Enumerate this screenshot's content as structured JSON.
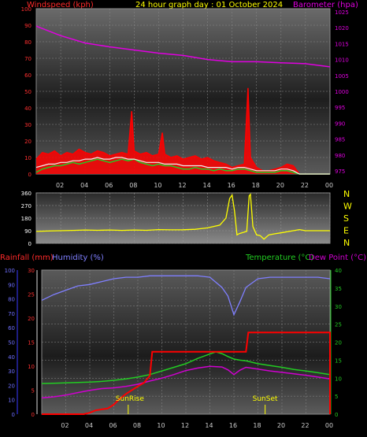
{
  "header": {
    "windspeed_label": "Windspeed (kph)",
    "title": "24 hour graph day : 01 October 2024",
    "barometer_label": "Barometer (hpa)"
  },
  "colors": {
    "background": "#000000",
    "wind": "#ff0000",
    "gust": "#ff0000",
    "barometer": "#e000e0",
    "direction": "#ffff00",
    "temperature": "#22cc22",
    "dewpoint": "#d000d0",
    "humidity": "#7f7fff",
    "rainfall": "#ff0000",
    "header_wind": "#ff2a2a",
    "header_title": "#ffff00",
    "header_baro": "#e000e0",
    "left_axis3": "#3a3aff",
    "right_axis3": "#22cc22"
  },
  "x_ticks": [
    "02",
    "04",
    "06",
    "08",
    "10",
    "12",
    "14",
    "16",
    "18",
    "20",
    "22",
    "00"
  ],
  "direction_labels": [
    "N",
    "W",
    "S",
    "E",
    "N"
  ],
  "chart_data": [
    {
      "type": "line",
      "name": "wind-barometer",
      "title": "24 hour graph day : 01 October 2024",
      "ylabel_left": "Windspeed (kph)",
      "ylabel_right": "Barometer (hpa)",
      "y_left_ticks": [
        0,
        10,
        20,
        30,
        40,
        50,
        60,
        70,
        80,
        90,
        100
      ],
      "y_left_range": [
        0,
        100
      ],
      "y_right_ticks": [
        975,
        980,
        985,
        990,
        995,
        1000,
        1005,
        1010,
        1015,
        1020,
        1025
      ],
      "y_right_range": [
        974,
        1026
      ],
      "series": [
        {
          "name": "Barometer",
          "axis": "right",
          "x": [
            0,
            2,
            4,
            6,
            8,
            10,
            12,
            14,
            16,
            18,
            20,
            22,
            24
          ],
          "values": [
            1020.5,
            1017.5,
            1015.2,
            1014.0,
            1013.0,
            1012.0,
            1011.3,
            1010.0,
            1009.3,
            1009.3,
            1009.0,
            1008.7,
            1007.7
          ]
        },
        {
          "name": "Gust",
          "axis": "left",
          "x": [
            0,
            0.5,
            1,
            1.5,
            2,
            2.5,
            3,
            3.5,
            4,
            4.5,
            5,
            5.5,
            6,
            6.5,
            7,
            7.5,
            7.8,
            8,
            8.5,
            9,
            9.5,
            10,
            10.3,
            10.5,
            11,
            11.5,
            12,
            12.5,
            13,
            13.5,
            14,
            14.5,
            15,
            15.5,
            16,
            16.5,
            17,
            17.3,
            17.5,
            18,
            18.5,
            19,
            19.5,
            20,
            20.5,
            21,
            21.5,
            22,
            22.5,
            23,
            24
          ],
          "values": [
            9,
            13,
            12,
            14,
            11,
            13,
            12,
            15,
            13,
            12,
            14,
            13,
            11,
            12,
            13,
            12,
            38,
            14,
            12,
            13,
            11,
            12,
            25,
            12,
            10,
            11,
            9,
            10,
            11,
            9,
            10,
            8,
            7,
            6,
            4,
            5,
            6,
            52,
            10,
            4,
            2,
            2,
            3,
            4,
            6,
            5,
            0,
            0,
            0,
            0,
            0
          ]
        },
        {
          "name": "Average",
          "axis": "left",
          "x": [
            0,
            0.5,
            1,
            1.5,
            2,
            2.5,
            3,
            3.5,
            4,
            4.5,
            5,
            5.5,
            6,
            6.5,
            7,
            7.5,
            8,
            8.5,
            9,
            9.5,
            10,
            10.5,
            11,
            11.5,
            12,
            12.5,
            13,
            13.5,
            14,
            14.5,
            15,
            15.5,
            16,
            16.5,
            17,
            17.5,
            18,
            18.5,
            19,
            19.5,
            20,
            20.5,
            21,
            21.5,
            22,
            23,
            24
          ],
          "values": [
            1,
            3,
            4,
            5,
            5,
            6,
            7,
            6,
            7,
            8,
            9,
            8,
            7,
            8,
            9,
            8,
            9,
            7,
            6,
            5,
            6,
            5,
            5,
            4,
            3,
            3,
            4,
            3,
            3,
            2,
            3,
            2,
            2,
            3,
            3,
            2,
            1,
            1,
            1,
            1,
            2,
            2,
            1,
            0,
            0,
            0,
            0
          ]
        },
        {
          "name": "Gust peak",
          "axis": "left",
          "x": [
            0,
            0.5,
            1,
            1.5,
            2,
            2.5,
            3,
            3.5,
            4,
            4.5,
            5,
            5.5,
            6,
            6.5,
            7,
            7.5,
            8,
            8.5,
            9,
            9.5,
            10,
            10.5,
            11,
            11.5,
            12,
            12.5,
            13,
            13.5,
            14,
            14.5,
            15,
            15.5,
            16,
            16.5,
            17,
            17.5,
            18,
            18.5,
            19,
            19.5,
            20,
            20.5,
            21,
            21.5,
            22,
            23,
            24
          ],
          "values": [
            4,
            5,
            6,
            6,
            7,
            7,
            8,
            8,
            9,
            9,
            10,
            9,
            9,
            10,
            10,
            9,
            9,
            8,
            7,
            7,
            7,
            6,
            6,
            6,
            5,
            5,
            5,
            5,
            4,
            4,
            4,
            4,
            3,
            4,
            4,
            3,
            2,
            2,
            2,
            2,
            3,
            3,
            2,
            0,
            0,
            0,
            0
          ]
        }
      ]
    },
    {
      "type": "line",
      "name": "wind-direction",
      "y_ticks": [
        0,
        90,
        180,
        270,
        360
      ],
      "y_range": [
        0,
        360
      ],
      "right_labels": [
        "N",
        "W",
        "S",
        "E",
        "N"
      ],
      "series": [
        {
          "name": "Direction",
          "x": [
            0,
            1,
            2,
            3,
            4,
            5,
            6,
            7,
            8,
            9,
            10,
            11,
            12,
            13,
            14,
            15,
            15.5,
            15.8,
            16,
            16.2,
            16.4,
            16.6,
            17,
            17.2,
            17.4,
            17.5,
            17.7,
            18,
            18.3,
            18.6,
            19,
            19.5,
            20,
            21,
            21.5,
            22,
            23,
            24
          ],
          "values": [
            85,
            88,
            90,
            92,
            95,
            93,
            95,
            92,
            95,
            93,
            98,
            96,
            97,
            100,
            110,
            130,
            180,
            320,
            345,
            230,
            60,
            70,
            80,
            85,
            340,
            350,
            120,
            60,
            55,
            30,
            60,
            68,
            75,
            90,
            98,
            90,
            90,
            90
          ]
        }
      ]
    },
    {
      "type": "line",
      "name": "temp-humidity-rain",
      "ylabel_left": "Rainfall (mm)",
      "ylabel_left2": "Humidity (%)",
      "ylabel_right": "Temperature (°C)",
      "ylabel_right2": "Dew Point (°C)",
      "y_rain_ticks": [
        0,
        5,
        10,
        15,
        20,
        25,
        30
      ],
      "y_rain_range": [
        0,
        30
      ],
      "y_hum_ticks": [
        0,
        10,
        20,
        30,
        40,
        50,
        60,
        70,
        80,
        90,
        100
      ],
      "y_hum_range": [
        0,
        100
      ],
      "y_temp_ticks": [
        0,
        5,
        10,
        15,
        20,
        25,
        30,
        35,
        40
      ],
      "y_temp_range": [
        0,
        40
      ],
      "annotations": [
        {
          "text": "SunRise",
          "x": 7.2
        },
        {
          "text": "SunSet",
          "x": 18.6
        }
      ],
      "series": [
        {
          "name": "Humidity",
          "axis": "hum",
          "x": [
            0,
            1,
            2,
            3,
            4,
            5,
            6,
            7,
            8,
            9,
            10,
            11,
            12,
            13,
            14,
            15,
            15.5,
            16,
            16.5,
            17,
            18,
            19,
            20,
            21,
            22,
            23,
            24
          ],
          "values": [
            79,
            83,
            86,
            89,
            90,
            92,
            94,
            95,
            95,
            96,
            96,
            96,
            96,
            96,
            95,
            88,
            82,
            69,
            78,
            88,
            94,
            95,
            95,
            95,
            95,
            95,
            94
          ]
        },
        {
          "name": "Temperature",
          "axis": "temp",
          "x": [
            0,
            1,
            2,
            3,
            4,
            5,
            6,
            7,
            8,
            9,
            10,
            11,
            12,
            13,
            14,
            14.5,
            15,
            15.5,
            16,
            16.5,
            17,
            18,
            19,
            20,
            21,
            22,
            23,
            24
          ],
          "values": [
            8.5,
            8.6,
            8.7,
            8.8,
            8.9,
            9.1,
            9.4,
            9.8,
            10.3,
            11,
            12,
            13,
            14,
            15.5,
            16.7,
            17.3,
            16.8,
            16,
            15.3,
            15,
            14.8,
            14,
            13.5,
            13,
            12.4,
            12,
            11.5,
            11
          ]
        },
        {
          "name": "Dew Point",
          "axis": "temp",
          "x": [
            0,
            1,
            2,
            3,
            4,
            5,
            6,
            7,
            8,
            9,
            10,
            11,
            12,
            13,
            14,
            15,
            15.5,
            16,
            16.5,
            17,
            18,
            19,
            20,
            21,
            22,
            23,
            24
          ],
          "values": [
            4.5,
            4.8,
            5.3,
            6,
            6.6,
            7.1,
            7.3,
            7.7,
            8.3,
            9.2,
            10,
            11,
            12.1,
            12.8,
            13.3,
            13.1,
            12.3,
            11,
            12.2,
            13,
            12.5,
            12,
            11.6,
            11.2,
            10.8,
            10.3,
            9.8
          ]
        },
        {
          "name": "Rainfall",
          "axis": "rain",
          "x": [
            0,
            3.5,
            4,
            4.5,
            5,
            5.5,
            6,
            6.5,
            7,
            7.5,
            8,
            8.5,
            9,
            9.2,
            17,
            17.2,
            24,
            24
          ],
          "values": [
            0,
            0,
            0.3,
            0.8,
            1,
            1.2,
            2,
            3.2,
            4.2,
            5,
            5.8,
            6.5,
            8,
            13,
            13,
            17,
            17,
            0
          ]
        }
      ]
    }
  ]
}
